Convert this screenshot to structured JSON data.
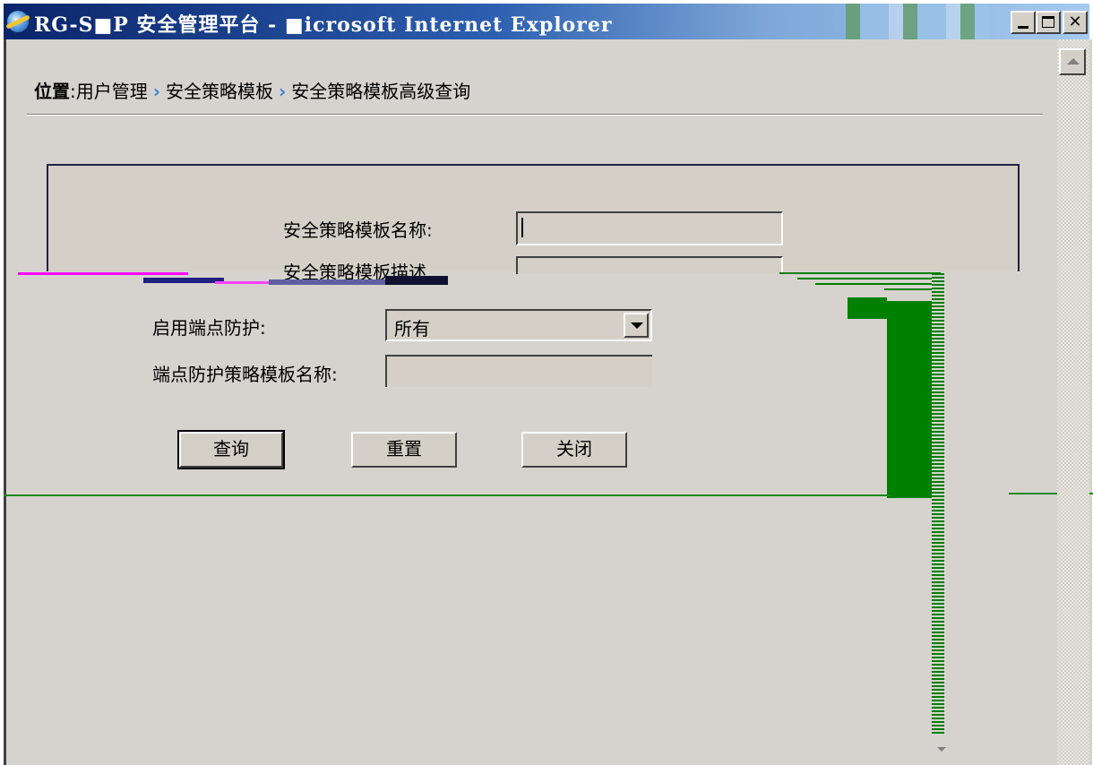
{
  "window": {
    "title": "RG-S■P 安全管理平台 - ■icrosoft Internet Explorer",
    "controls": {
      "minimize": "_",
      "maximize": "□",
      "close": "✕"
    },
    "icon": "ie-icon"
  },
  "breadcrumb": {
    "lead": "位置",
    "colon": ":",
    "items": [
      "用户管理",
      "安全策略模板",
      "安全策略模板高级查询"
    ],
    "separator": "›"
  },
  "form": {
    "fields": [
      {
        "label": "安全策略模板名称:",
        "value": ""
      },
      {
        "label": "安全策略模板描述",
        "value": ""
      },
      {
        "label": "启用端点防护:",
        "value": "所有"
      },
      {
        "label": "端点防护策略模板名称:",
        "value": ""
      }
    ]
  },
  "buttons": {
    "query": "查询",
    "reset": "重置",
    "close": "关闭"
  },
  "colors": {
    "title_bar": "#0a246a",
    "accent_green": "#008000",
    "breadcrumb_separator": "#3a7fd5",
    "window_bg": "#d6d3ce"
  }
}
